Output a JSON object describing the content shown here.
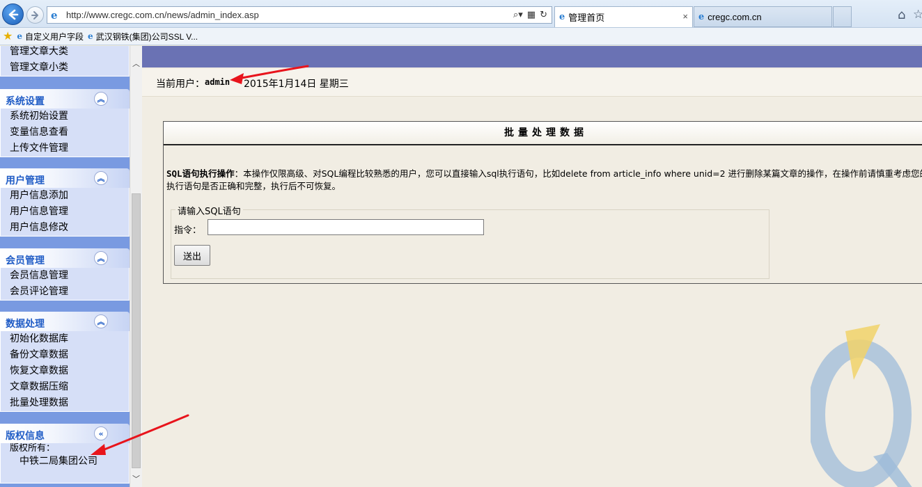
{
  "browser": {
    "url": "http://www.cregc.com.cn/news/admin_index.asp",
    "tabs": [
      {
        "title": "管理首页",
        "active": true,
        "close": "×"
      },
      {
        "title": "cregc.com.cn",
        "active": false
      }
    ],
    "favorites": [
      "自定义用户字段",
      "武汉钢铁(集团)公司SSL V..."
    ]
  },
  "sidebar": {
    "top_items": [
      "管理文章大类",
      "管理文章小类"
    ],
    "groups": [
      {
        "title": "系统设置",
        "items": [
          "系统初始设置",
          "变量信息查看",
          "上传文件管理"
        ]
      },
      {
        "title": "用户管理",
        "items": [
          "用户信息添加",
          "用户信息管理",
          "用户信息修改"
        ]
      },
      {
        "title": "会员管理",
        "items": [
          "会员信息管理",
          "会员评论管理"
        ]
      },
      {
        "title": "数据处理",
        "items": [
          "初始化数据库",
          "备份文章数据",
          "恢复文章数据",
          "文章数据压缩",
          "批量处理数据"
        ]
      },
      {
        "title": "版权信息",
        "items": [
          "版权所有：",
          "中铁二局集团公司"
        ]
      }
    ],
    "collapse_glyph": "︽",
    "expand_glyph": "«"
  },
  "header": {
    "user_label": "当前用户：",
    "user_name": "admin",
    "date": "2015年1月14日 星期三"
  },
  "panel": {
    "title": "批量处理数据",
    "desc_bold": "SQL语句执行操作",
    "desc_text": "：本操作仅限高级、对SQL编程比较熟悉的用户，您可以直接输入sql执行语句，比如delete from article_info where unid=2 进行删除某篇文章的操作，在操作前请慎重考虑您的执行语句是否正确和完整，执行后不可恢复。",
    "legend": "请输入SQL语句",
    "cmd_label": "指令：",
    "cmd_value": "",
    "submit_label": "送出"
  },
  "colors": {
    "sidebar_bg": "#799ae1",
    "group_title": "#215dc6",
    "top_band": "#6a72b4",
    "arrow": "#e8141c"
  },
  "icons": [
    "back-arrow-icon",
    "forward-arrow-icon",
    "ie-logo-icon",
    "search-icon",
    "refresh-icon",
    "home-icon",
    "favorites-star-icon",
    "collapse-icon"
  ]
}
